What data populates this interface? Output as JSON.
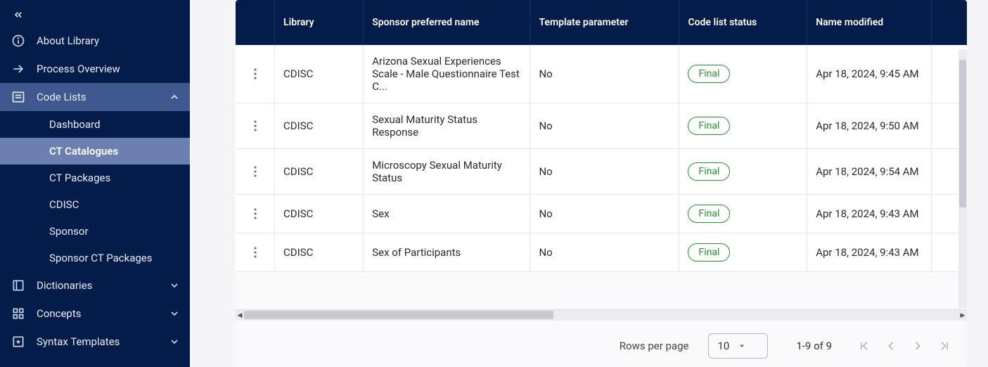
{
  "sidebar": {
    "items": [
      {
        "label": "About Library",
        "icon": "info-icon",
        "expandable": false
      },
      {
        "label": "Process Overview",
        "icon": "arrow-right-icon",
        "expandable": false
      },
      {
        "label": "Code Lists",
        "icon": "list-icon",
        "expandable": true,
        "expanded": true,
        "active": true,
        "children": [
          {
            "label": "Dashboard",
            "selected": false
          },
          {
            "label": "CT Catalogues",
            "selected": true
          },
          {
            "label": "CT Packages",
            "selected": false
          },
          {
            "label": "CDISC",
            "selected": false
          },
          {
            "label": "Sponsor",
            "selected": false
          },
          {
            "label": "Sponsor CT Packages",
            "selected": false
          }
        ]
      },
      {
        "label": "Dictionaries",
        "icon": "book-icon",
        "expandable": true,
        "expanded": false
      },
      {
        "label": "Concepts",
        "icon": "grid-icon",
        "expandable": true,
        "expanded": false
      },
      {
        "label": "Syntax Templates",
        "icon": "template-icon",
        "expandable": true,
        "expanded": false
      }
    ]
  },
  "table": {
    "headers": {
      "library": "Library",
      "sponsor_name": "Sponsor preferred name",
      "template_param": "Template parameter",
      "status": "Code list status",
      "name_modified": "Name modified"
    },
    "rows": [
      {
        "library": "CDISC",
        "sponsor_name": "Arizona Sexual Experiences Scale - Male Questionnaire Test C...",
        "template_param": "No",
        "status": "Final",
        "name_modified": "Apr 18, 2024, 9:45 AM"
      },
      {
        "library": "CDISC",
        "sponsor_name": "Sexual Maturity Status Response",
        "template_param": "No",
        "status": "Final",
        "name_modified": "Apr 18, 2024, 9:50 AM"
      },
      {
        "library": "CDISC",
        "sponsor_name": "Microscopy Sexual Maturity Status",
        "template_param": "No",
        "status": "Final",
        "name_modified": "Apr 18, 2024, 9:54 AM"
      },
      {
        "library": "CDISC",
        "sponsor_name": "Sex",
        "template_param": "No",
        "status": "Final",
        "name_modified": "Apr 18, 2024, 9:43 AM"
      },
      {
        "library": "CDISC",
        "sponsor_name": "Sex of Participants",
        "template_param": "No",
        "status": "Final",
        "name_modified": "Apr 18, 2024, 9:43 AM"
      }
    ]
  },
  "pagination": {
    "rows_label": "Rows per page",
    "rows_per_page": "10",
    "page_info": "1-9 of 9"
  }
}
